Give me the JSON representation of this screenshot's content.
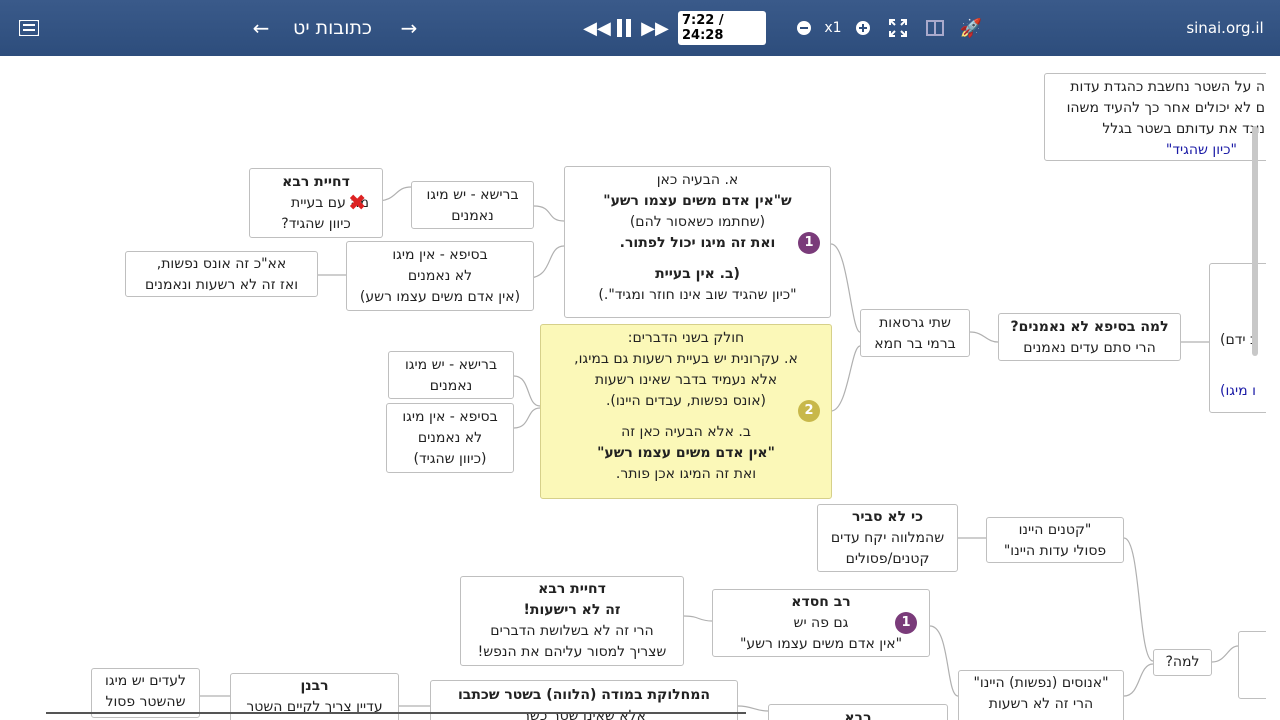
{
  "toolbar": {
    "title": "כתובות יט",
    "time": "7:22 / 24:28",
    "speed": "x1",
    "site": "sinai.org.il",
    "colors": {
      "bar": "#2d4d7c",
      "accent": "#ffffff"
    }
  },
  "nodes": {
    "top_right": [
      "ה על השטר נחשבת כהגדת עדות",
      "ם לא יכולים אחר כך להעיד משהו",
      "נוגד את עדותם בשטר בגלל",
      "\"כיון שהגיד\""
    ],
    "a_main": [
      "א. הבעיה כאן",
      "ש\"אין אדם משים עצמו רשע\"",
      "(שחתמו כשאסור להם)",
      "ואת זה מיגו יכול לפתור.",
      "",
      "(ב. אין בעיית",
      "\"כיון שהגיד שוב אינו חוזר ומגיד\".)"
    ],
    "reisha1": [
      "ברישא - יש מיגו",
      "נאמנים"
    ],
    "sefa1": [
      "בסיפא - אין מיגו",
      "לא נאמנים",
      "(אין אדם משים עצמו רשע)"
    ],
    "dachiyat1": [
      "דחיית רבא",
      "מה עם בעיית",
      "כיוון שהגיד?"
    ],
    "ak": [
      "אא\"כ זה אונס נפשות,",
      "ואז זה לא רשעות  ונאמנים"
    ],
    "yellow": [
      "חולק  בשני הדברים:",
      "א. עקרונית יש בעיית רשעות גם במיגו,",
      "אלא נעמיד בדבר שאינו רשעות",
      "(אונס נפשות, עבדים היינו).",
      "",
      "ב. אלא הבעיה כאן זה",
      "\"אין אדם משים עצמו רשע\"",
      "ואת זה המיגו אכן פותר."
    ],
    "reisha2": [
      "ברישא - יש מיגו",
      "נאמנים"
    ],
    "sefa2": [
      "בסיפא - אין מיגו",
      "לא נאמנים",
      "(כיוון שהגיד)"
    ],
    "shtei": [
      "שתי גרסאות",
      "ברמי בר חמא"
    ],
    "lama": [
      "למה בסיפא לא נאמנים?",
      "הרי סתם עדים נאמנים"
    ],
    "right_mid": [
      "ב ידם)",
      "ו מיגו)"
    ],
    "ki": [
      "כי לא סביר",
      "שהמלווה יקח עדים",
      "קטנים/פסולים"
    ],
    "ktanim": [
      "\"קטנים היינו",
      "פסולי עדות היינו\""
    ],
    "lamaq": [
      "למה?"
    ],
    "rav_chisda": [
      "רב חסדא",
      "גם פה יש",
      "\"אין אדם משים עצמו רשע\""
    ],
    "dachiyat2": [
      "דחיית רבא",
      "זה לא רישעות!",
      "הרי זה לא בשלושת הדברים",
      "שצריך למסור עליהם את הנפש!"
    ],
    "anusim": [
      "\"אנוסים (נפשות) היינו\"",
      "הרי זה לא רשעות"
    ],
    "rabanan": [
      "רבנן",
      "עדיין צריך לקיים השטר"
    ],
    "leedim": [
      "לעדים יש מיגו",
      "שהשטר פסול"
    ],
    "machloket": [
      "המחלוקת במודה (הלווה) בשטר שכתבו",
      "אלא שאינו שטר כשר"
    ],
    "rava": [
      "רבא"
    ],
    "badge1": "1",
    "badge2": "2"
  }
}
